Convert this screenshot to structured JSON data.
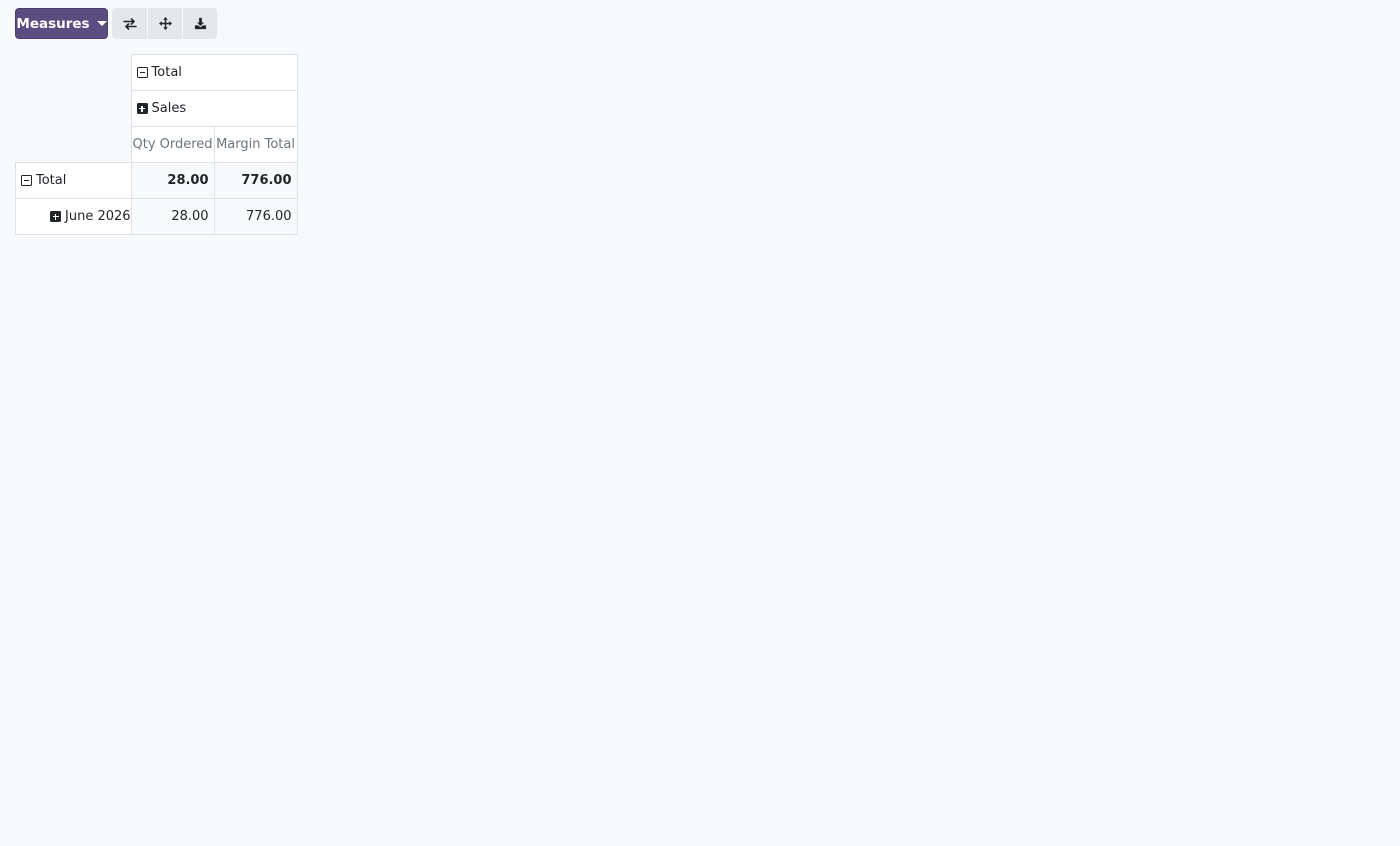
{
  "toolbar": {
    "measures_label": "Measures",
    "buttons": [
      {
        "icon": "flip-axis-icon"
      },
      {
        "icon": "expand-all-icon"
      },
      {
        "icon": "download-icon"
      }
    ]
  },
  "pivot": {
    "column_header_total": "Total",
    "column_group_sales": "Sales",
    "measures": [
      "Qty Ordered",
      "Margin Total"
    ],
    "rows": [
      {
        "label": "Total",
        "expanded": true,
        "values": [
          "28.00",
          "776.00"
        ],
        "bold": true
      },
      {
        "label": "June 2026",
        "expanded": false,
        "values": [
          "28.00",
          "776.00"
        ],
        "bold": false
      }
    ]
  },
  "colors": {
    "primary": "#5a4d80",
    "background": "#f8f9fb",
    "border": "#dee2e6",
    "muted_text": "#6c757d"
  }
}
